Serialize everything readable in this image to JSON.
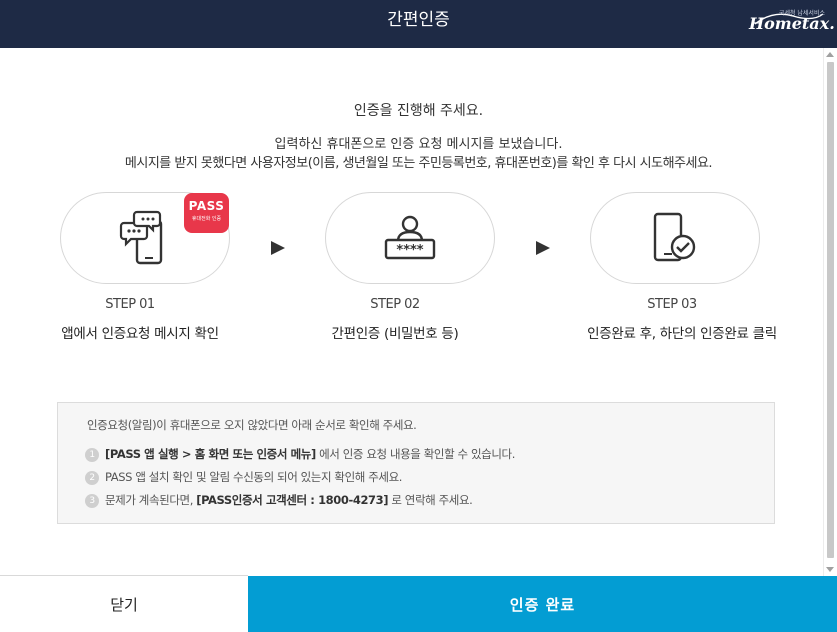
{
  "header": {
    "title": "간편인증",
    "logo_small": "국세청 납세서비스",
    "logo_main": "Hometax."
  },
  "intro": {
    "title": "인증을 진행해 주세요.",
    "desc_line1": "입력하신 휴대폰으로 인증 요청 메시지를 보냈습니다.",
    "desc_line2": "메시지를 받지 못했다면 사용자정보(이름, 생년월일 또는 주민등록번호, 휴대폰번호)를 확인 후 다시 시도해주세요."
  },
  "pass_badge": {
    "label": "PASS",
    "sub": "휴대전화 인증"
  },
  "steps": [
    {
      "num": "STEP 01",
      "desc": "앱에서 인증요청 메시지 확인",
      "icon": "phone-message-icon"
    },
    {
      "num": "STEP 02",
      "desc": "간편인증 (비밀번호 등)",
      "icon": "user-password-icon"
    },
    {
      "num": "STEP 03",
      "desc": "인증완료 후, 하단의 인증완료 클릭",
      "icon": "phone-check-icon"
    }
  ],
  "info": {
    "title": "인증요청(알림)이 휴대폰으로 오지 않았다면 아래 순서로 확인해 주세요.",
    "items": [
      {
        "num": "1",
        "bold": "[PASS 앱 실행 > 홈 화면 또는 인증서 메뉴]",
        "text": " 에서 인증 요청 내용을 확인할 수 있습니다."
      },
      {
        "num": "2",
        "bold": "",
        "text": "PASS 앱 설치 확인 및 알림 수신동의 되어 있는지 확인해 주세요."
      },
      {
        "num": "3",
        "pre": "문제가 계속된다면, ",
        "bold": "[PASS인증서 고객센터 : 1800-4273]",
        "text": " 로 연락해 주세요."
      }
    ]
  },
  "footer": {
    "close_label": "닫기",
    "confirm_label": "인증 완료"
  },
  "colors": {
    "header_bg": "#1e2a45",
    "confirm_bg": "#039dd3",
    "pass_badge": "#e8374a"
  }
}
